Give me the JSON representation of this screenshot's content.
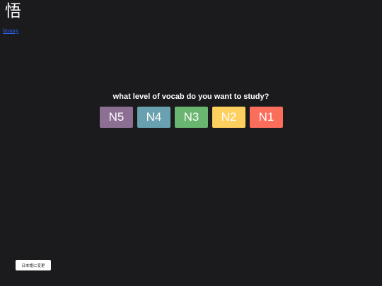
{
  "header": {
    "logo_text": "悟",
    "link_label": "history"
  },
  "main": {
    "prompt": "what level of vocab do you want to study?",
    "levels": [
      {
        "label": "N5",
        "color": "#8e6f94"
      },
      {
        "label": "N4",
        "color": "#6aa1b0"
      },
      {
        "label": "N3",
        "color": "#6ab56f"
      },
      {
        "label": "N2",
        "color": "#fdcf5e"
      },
      {
        "label": "N1",
        "color": "#fb6e5c"
      }
    ]
  },
  "footer": {
    "language_button_label": "日本語に変更"
  }
}
